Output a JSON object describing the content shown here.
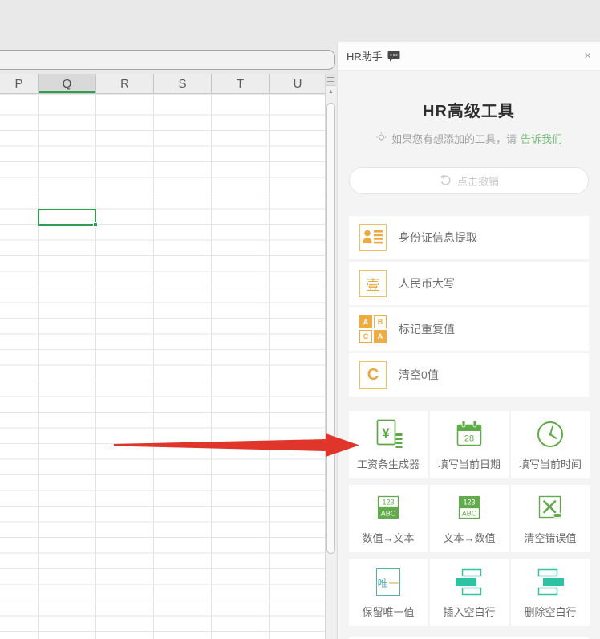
{
  "spreadsheet": {
    "columns": [
      "P",
      "Q",
      "R",
      "S",
      "T",
      "U"
    ],
    "selected_column": "Q",
    "scroll_up_glyph": "▲"
  },
  "panel": {
    "header": {
      "title": "HR助手",
      "close_glyph": "×"
    },
    "title": "HR高级工具",
    "subtitle_prefix": "如果您有想添加的工具，请",
    "subtitle_link": "告诉我们",
    "undo_label": "点击撤销",
    "list_tools": [
      {
        "label": "身份证信息提取"
      },
      {
        "label": "人民币大写",
        "glyph": "壹"
      },
      {
        "label": "标记重复值",
        "cells": [
          "A",
          "B",
          "C",
          "A"
        ]
      },
      {
        "label": "清空0值",
        "glyph": "C"
      }
    ],
    "grid_tools": [
      {
        "label": "工资条生成器",
        "glyph": "¥"
      },
      {
        "label": "填写当前日期",
        "day": "28"
      },
      {
        "label": "填写当前时间"
      },
      {
        "label": "数值→文本",
        "top": "123",
        "bottom": "ABC"
      },
      {
        "label": "文本→数值",
        "top": "123",
        "bottom": "ABC"
      },
      {
        "label": "清空错误值"
      },
      {
        "label": "保留唯一值",
        "glyph_a": "唯",
        "glyph_b": "一"
      },
      {
        "label": "插入空白行"
      },
      {
        "label": "删除空白行"
      }
    ]
  },
  "colors": {
    "orange": "#eaa93d",
    "green": "#5fa84a",
    "teal": "#2fc2a2",
    "link_green": "#72bd77",
    "arrow_red": "#e0352b",
    "selection_green": "#2f9e4f"
  }
}
